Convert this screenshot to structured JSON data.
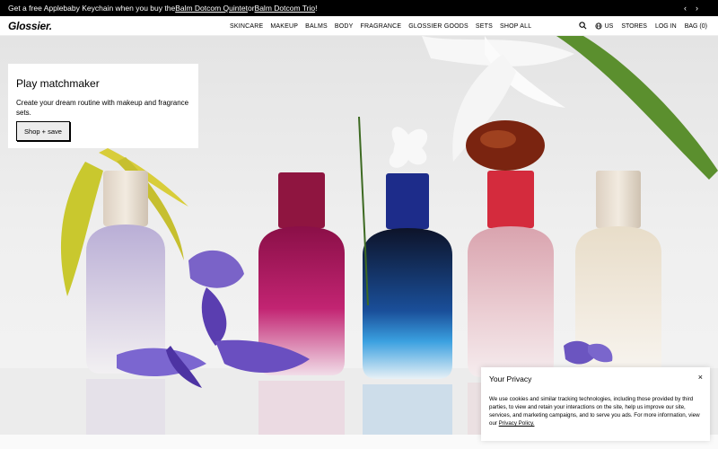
{
  "announcement": {
    "prefix": "Get a free Applebaby Keychain when you buy the ",
    "link1": "Balm Dotcom Quintet",
    "mid": " or ",
    "link2": "Balm Dotcom Trio",
    "suffix": "!",
    "prev_icon": "chevron-left-icon",
    "next_icon": "chevron-right-icon"
  },
  "nav": {
    "logo": "Glossier.",
    "items": [
      "SKINCARE",
      "MAKEUP",
      "BALMS",
      "BODY",
      "FRAGRANCE",
      "GLOSSIER GOODS",
      "SETS",
      "SHOP ALL"
    ],
    "region": "US",
    "stores": "STORES",
    "login": "LOG IN",
    "bag": "BAG (0)"
  },
  "promo": {
    "title": "Play matchmaker",
    "body": "Create your dream routine with makeup and fragrance sets.",
    "button": "Shop + save"
  },
  "privacy": {
    "title": "Your Privacy",
    "body": "We use cookies and similar tracking technologies, including those provided by third parties, to view and retain your interactions on the site, help us improve our site, services, and marketing campaigns, and to serve you ads. For more information, view our ",
    "link": "Privacy Policy.",
    "close": "×"
  },
  "colors": {
    "announce_bg": "#000000",
    "bottle_purple": "#cfc2dc",
    "bottle_magenta": "#a3155a",
    "bottle_blue": "#1d2c5e",
    "bottle_pink": "#e2b7c0",
    "bottle_cream": "#efe3d3"
  }
}
